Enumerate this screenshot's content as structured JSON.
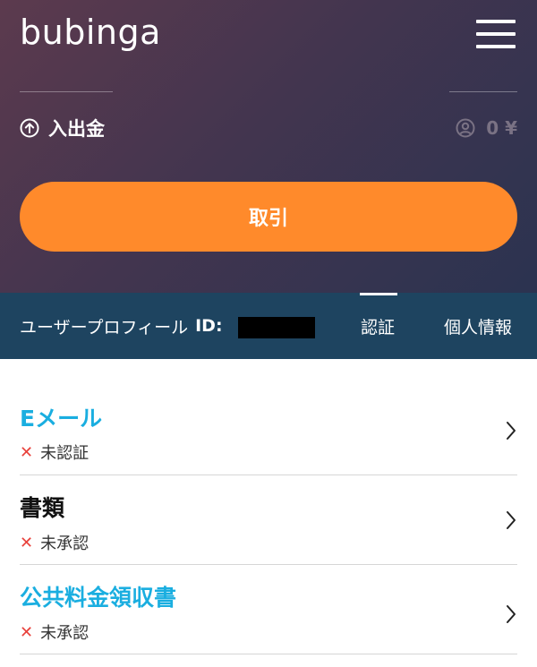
{
  "header": {
    "logo": "bubinga",
    "menu_icon": "hamburger-menu-icon",
    "deposit_label": "入出金",
    "deposit_icon": "arrow-up-circle-icon",
    "balance_icon": "user-circle-icon",
    "balance": "0 ¥",
    "trade_button": "取引"
  },
  "profile_bar": {
    "profile_label": "ユーザープロフィール",
    "id_label": "ID:",
    "tabs": [
      {
        "label": "認証",
        "active": true
      },
      {
        "label": "個人情報",
        "active": false
      }
    ]
  },
  "verification_items": [
    {
      "title": "Eメール",
      "status": "未認証",
      "status_icon": "x-icon",
      "title_color": "#1aaee0"
    },
    {
      "title": "書類",
      "status": "未承認",
      "status_icon": "x-icon",
      "title_color": "#111111"
    },
    {
      "title": "公共料金領収書",
      "status": "未承認",
      "status_icon": "x-icon",
      "title_color": "#1aaee0"
    }
  ],
  "colors": {
    "accent_orange": "#ff8a2b",
    "bar_blue": "#1e4460",
    "link_blue": "#1aaee0",
    "error_red": "#e8413b"
  }
}
